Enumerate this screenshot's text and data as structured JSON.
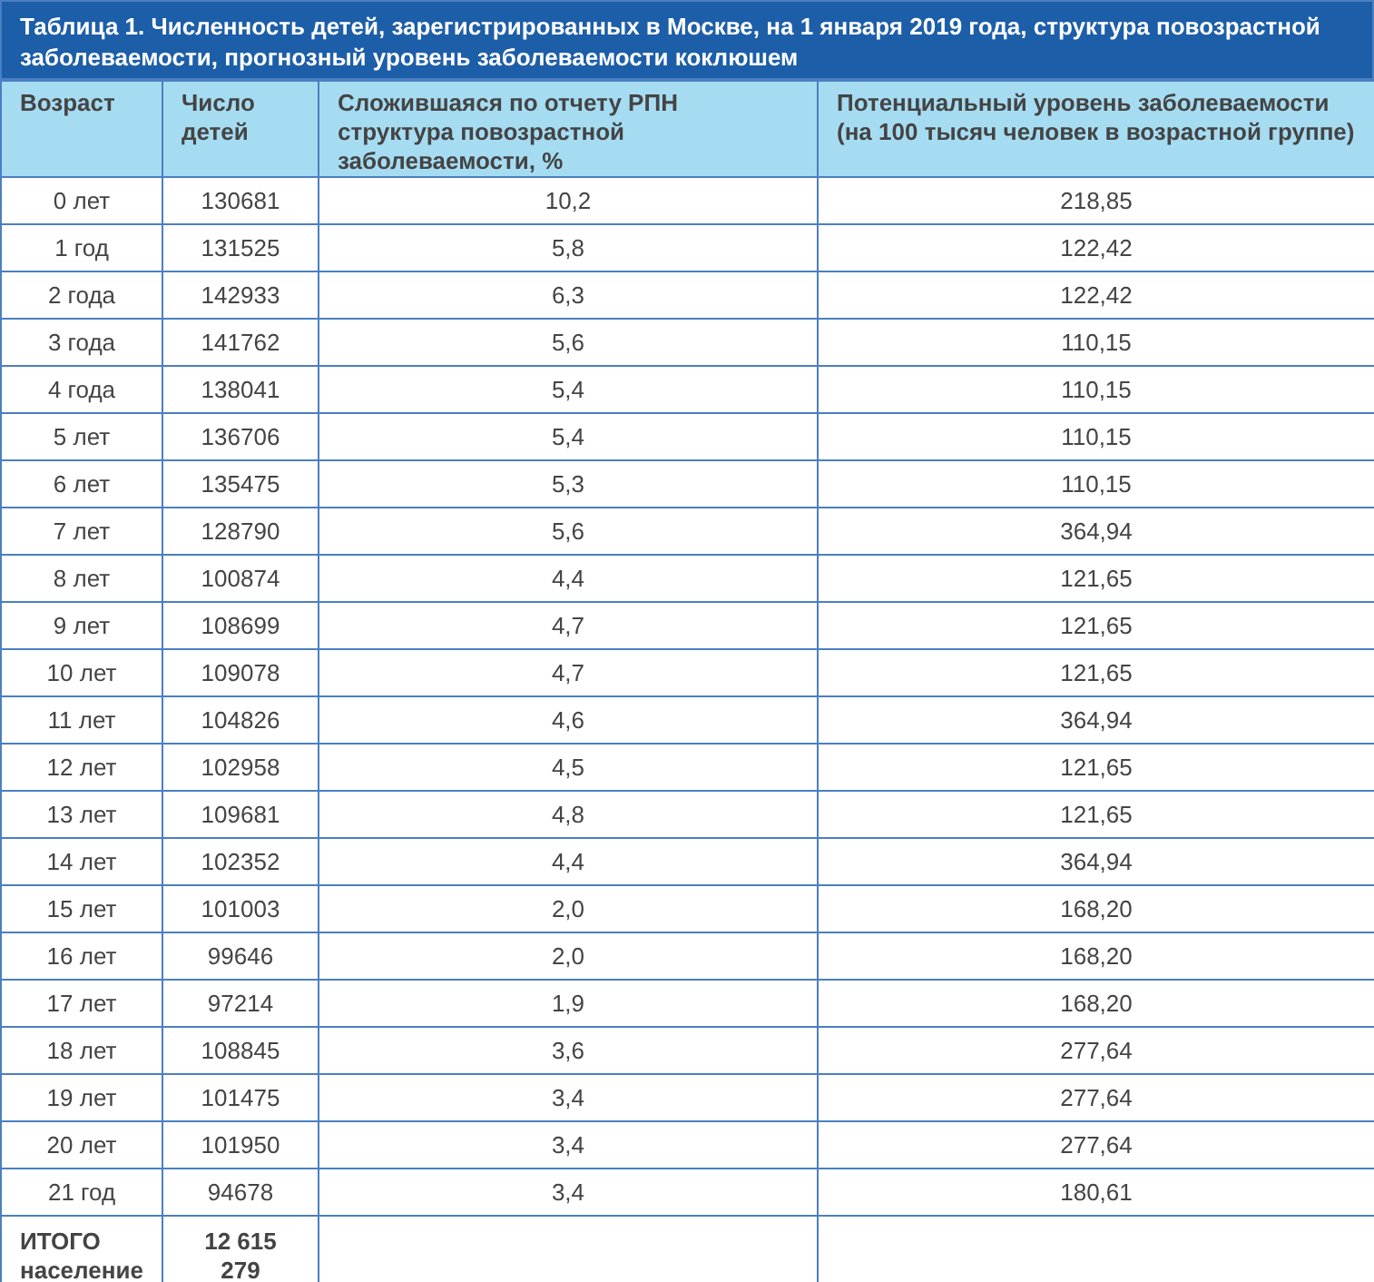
{
  "title": "Таблица 1. Численность детей, зарегистрированных в Москве, на 1 января 2019 года, структура повозрастной заболеваемости, прогнозный уровень заболеваемости коклюшем",
  "columns": [
    "Возраст",
    "Число детей",
    "Сложившаяся по отчету РПН структура повозрастной заболеваемости, %",
    "Потенциальный уровень заболеваемости (на 100 тысяч человек в возрастной группе)"
  ],
  "rows": [
    [
      "0 лет",
      "130681",
      "10,2",
      "218,85"
    ],
    [
      "1 год",
      "131525",
      "5,8",
      "122,42"
    ],
    [
      "2 года",
      "142933",
      "6,3",
      "122,42"
    ],
    [
      "3 года",
      "141762",
      "5,6",
      "110,15"
    ],
    [
      "4 года",
      "138041",
      "5,4",
      "110,15"
    ],
    [
      "5 лет",
      "136706",
      "5,4",
      "110,15"
    ],
    [
      "6 лет",
      "135475",
      "5,3",
      "110,15"
    ],
    [
      "7 лет",
      "128790",
      "5,6",
      "364,94"
    ],
    [
      "8 лет",
      "100874",
      "4,4",
      "121,65"
    ],
    [
      "9 лет",
      "108699",
      "4,7",
      "121,65"
    ],
    [
      "10 лет",
      "109078",
      "4,7",
      "121,65"
    ],
    [
      "11 лет",
      "104826",
      "4,6",
      "364,94"
    ],
    [
      "12 лет",
      "102958",
      "4,5",
      "121,65"
    ],
    [
      "13 лет",
      "109681",
      "4,8",
      "121,65"
    ],
    [
      "14 лет",
      "102352",
      "4,4",
      "364,94"
    ],
    [
      "15 лет",
      "101003",
      "2,0",
      "168,20"
    ],
    [
      "16 лет",
      "99646",
      "2,0",
      "168,20"
    ],
    [
      "17 лет",
      "97214",
      "1,9",
      "168,20"
    ],
    [
      "18 лет",
      "108845",
      "3,6",
      "277,64"
    ],
    [
      "19 лет",
      "101475",
      "3,4",
      "277,64"
    ],
    [
      "20 лет",
      "101950",
      "3,4",
      "277,64"
    ],
    [
      "21 год",
      "94678",
      "3,4",
      "180,61"
    ]
  ],
  "total": {
    "label": "ИТОГО население",
    "value": "12 615\n279"
  }
}
